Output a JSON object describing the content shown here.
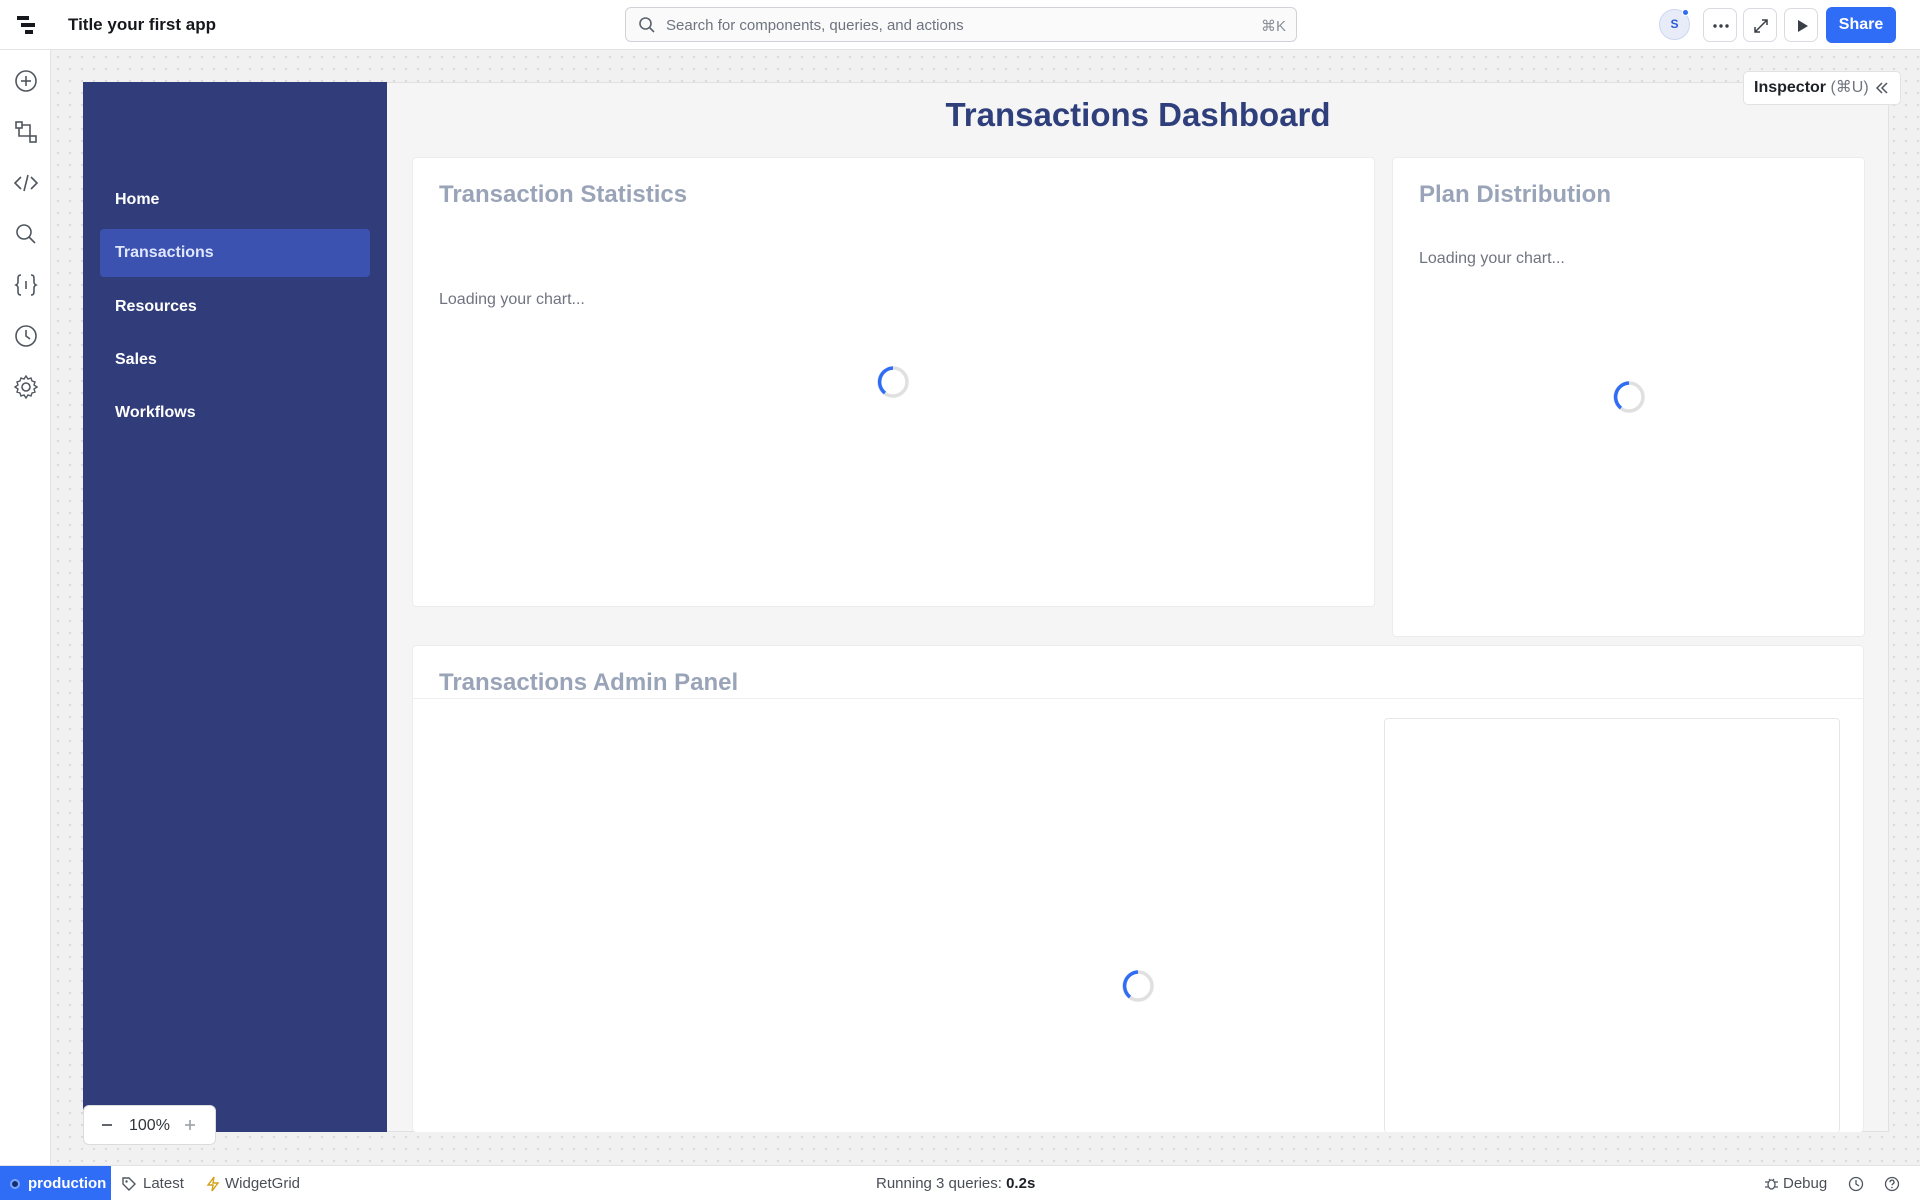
{
  "header": {
    "app_title": "Title your first app",
    "search_placeholder": "Search for components, queries, and actions",
    "search_shortcut": "⌘K",
    "avatar_initial": "S",
    "share_label": "Share"
  },
  "rail": {
    "icons": [
      "add-icon",
      "workflow-icon",
      "code-icon",
      "search-icon",
      "variables-icon",
      "history-icon",
      "settings-icon",
      "ai-assist-icon"
    ]
  },
  "sidenav": {
    "items": [
      {
        "label": "Home",
        "active": false
      },
      {
        "label": "Transactions",
        "active": true
      },
      {
        "label": "Resources",
        "active": false
      },
      {
        "label": "Sales",
        "active": false
      },
      {
        "label": "Workflows",
        "active": false
      }
    ]
  },
  "dashboard": {
    "title": "Transactions Dashboard",
    "stats_card": {
      "title": "Transaction Statistics",
      "loading": "Loading your chart..."
    },
    "plan_card": {
      "title": "Plan Distribution",
      "loading": "Loading your chart..."
    },
    "admin_card": {
      "title": "Transactions Admin Panel"
    }
  },
  "inspector": {
    "label": "Inspector",
    "shortcut": "(⌘U)"
  },
  "zoom": {
    "value": "100%"
  },
  "statusbar": {
    "environment": "production",
    "version": "Latest",
    "widget": "WidgetGrid",
    "running_prefix": "Running 3 queries:",
    "running_time": "0.2s",
    "debug": "Debug"
  },
  "colors": {
    "accent": "#2f6df6",
    "sidenav_bg": "#313d7a",
    "title": "#2f3f7c"
  }
}
